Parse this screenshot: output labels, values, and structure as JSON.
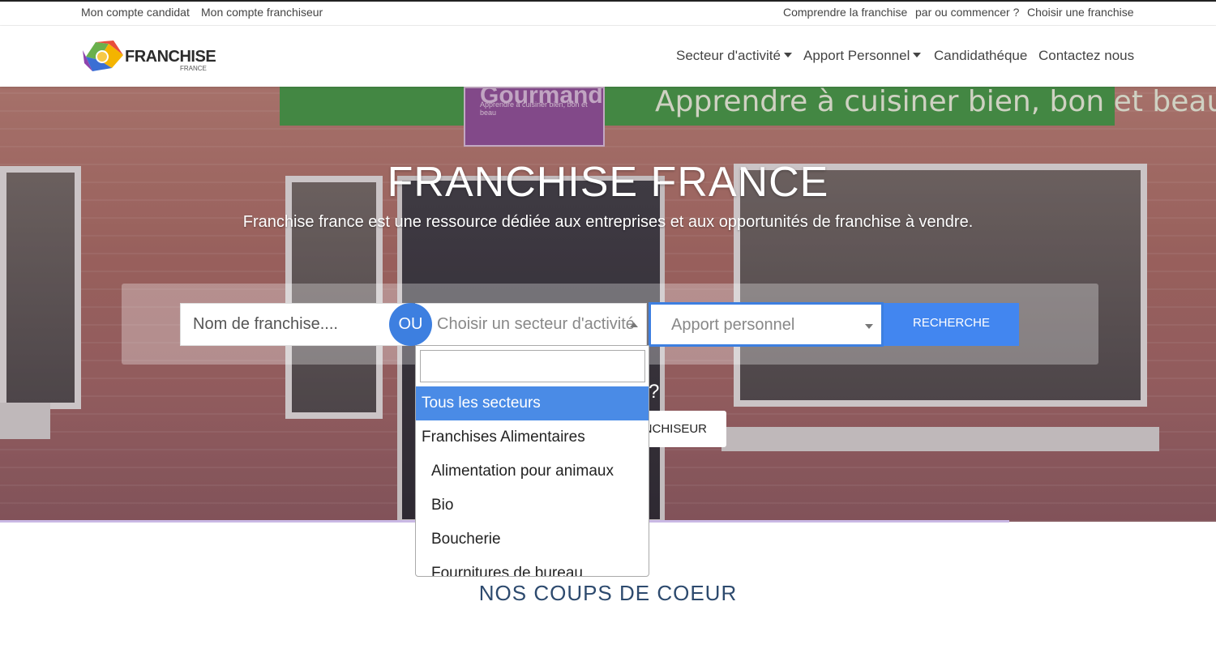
{
  "topbar": {
    "left_links": [
      "Mon compte candidat",
      "Mon compte franchiseur"
    ],
    "right_links": [
      "Comprendre la franchise",
      "par ou commencer ?",
      "Choisir une franchise"
    ]
  },
  "brand": {
    "logo_text": "FRANCHISE",
    "logo_sub": "FRANCE"
  },
  "nav": {
    "secteur": "Secteur d'activité",
    "apport": "Apport Personnel",
    "candidatheque": "Candidathéque",
    "contact": "Contactez nous"
  },
  "hero": {
    "sign_text": "Apprendre à cuisiner bien, bon et beau",
    "sign_brand": "Gourmand",
    "sign_brand_sub": "Apprendre à cuisiner bien, bon et beau",
    "title": "FRANCHISE FRANCE",
    "subtitle": "Franchise france est une ressource dédiée aux entreprises et aux opportunités de franchise à vendre."
  },
  "search": {
    "name_placeholder": "Nom de franchise....",
    "ou_label": "OU",
    "sector_placeholder": "Choisir un secteur d'activité",
    "apport_placeholder": "Apport personnel",
    "button_label": "RECHERCHE"
  },
  "hero_cta": {
    "question": "?",
    "franchiseur_label": "NCHISEUR"
  },
  "dropdown": {
    "search_value": "",
    "options": [
      {
        "label": "Tous les secteurs",
        "kind": "selected"
      },
      {
        "label": "Franchises Alimentaires",
        "kind": "group"
      },
      {
        "label": "Alimentation pour animaux",
        "kind": "item"
      },
      {
        "label": "Bio",
        "kind": "item"
      },
      {
        "label": "Boucherie",
        "kind": "item"
      },
      {
        "label": "Fournitures de bureau",
        "kind": "item"
      }
    ]
  },
  "section": {
    "coups_de_coeur": "NOS COUPS DE COEUR"
  },
  "colors": {
    "accent": "#3d7fe0",
    "button": "#4286f0",
    "selected_option": "#4a8be6",
    "heading": "#2d4a6e"
  }
}
